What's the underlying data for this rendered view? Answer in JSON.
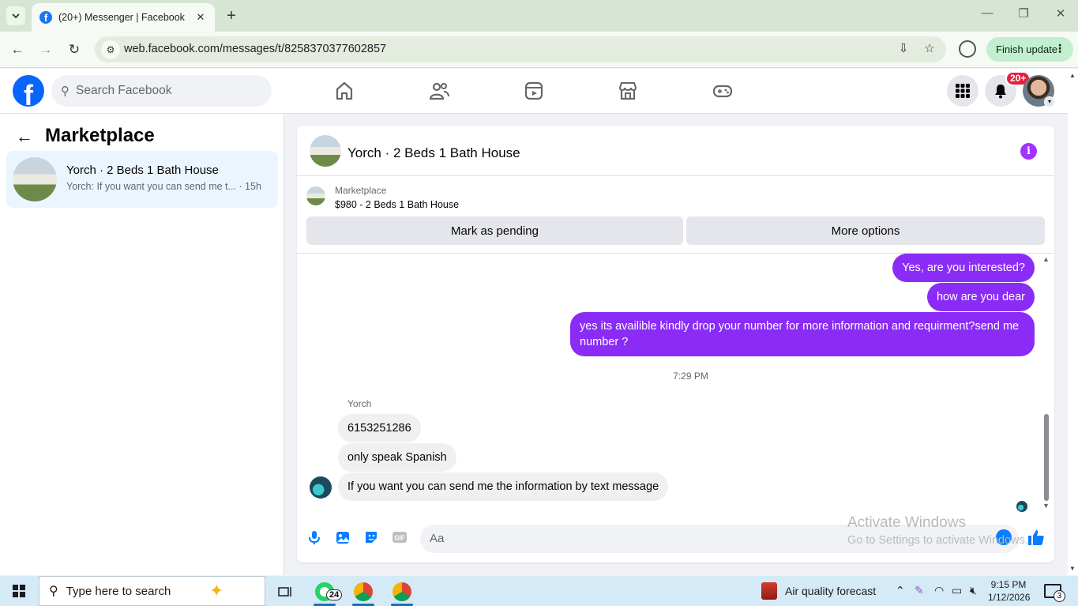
{
  "browser": {
    "tab_title": "(20+) Messenger | Facebook",
    "url": "web.facebook.com/messages/t/8258370377602857",
    "finish_update_label": "Finish update"
  },
  "fb_nav": {
    "search_placeholder": "Search Facebook",
    "notification_count": "20+",
    "icons": [
      "home-icon",
      "friends-icon",
      "video-icon",
      "marketplace-icon",
      "gaming-icon",
      "menu-grid-icon",
      "bell-icon"
    ]
  },
  "sidebar": {
    "title": "Marketplace",
    "conversations": [
      {
        "name": "Yorch · 2 Beds 1 Bath House",
        "preview": "Yorch: If you want you can send me t... · 15h"
      }
    ]
  },
  "chat": {
    "title": "Yorch · 2 Beds 1 Bath House",
    "listing": {
      "label": "Marketplace",
      "price_title": "$980 - 2 Beds 1 Bath House",
      "mark_pending_label": "Mark as pending",
      "more_options_label": "More options"
    },
    "outgoing": [
      "Yes, are you interested?",
      "how are you dear",
      "yes its availible kindly drop your number for more information and requirment?send me number ?"
    ],
    "timestamp": "7:29 PM",
    "sender_name": "Yorch",
    "incoming": [
      "6153251286",
      "only speak Spanish",
      "If you want you can send me the information by text message"
    ],
    "composer_placeholder": "Aa"
  },
  "watermark": {
    "line1": "Activate Windows",
    "line2": "Go to Settings to activate Windows."
  },
  "taskbar": {
    "search_placeholder": "Type here to search",
    "whatsapp_badge": "24",
    "weather_label": "Air quality forecast",
    "time": "9:15 PM",
    "date": "1/12/2026",
    "notification_count": "3"
  },
  "colors": {
    "messenger_purple": "#8a2cf6",
    "facebook_blue": "#0866ff",
    "selected_conversation": "#ebf5ff"
  }
}
